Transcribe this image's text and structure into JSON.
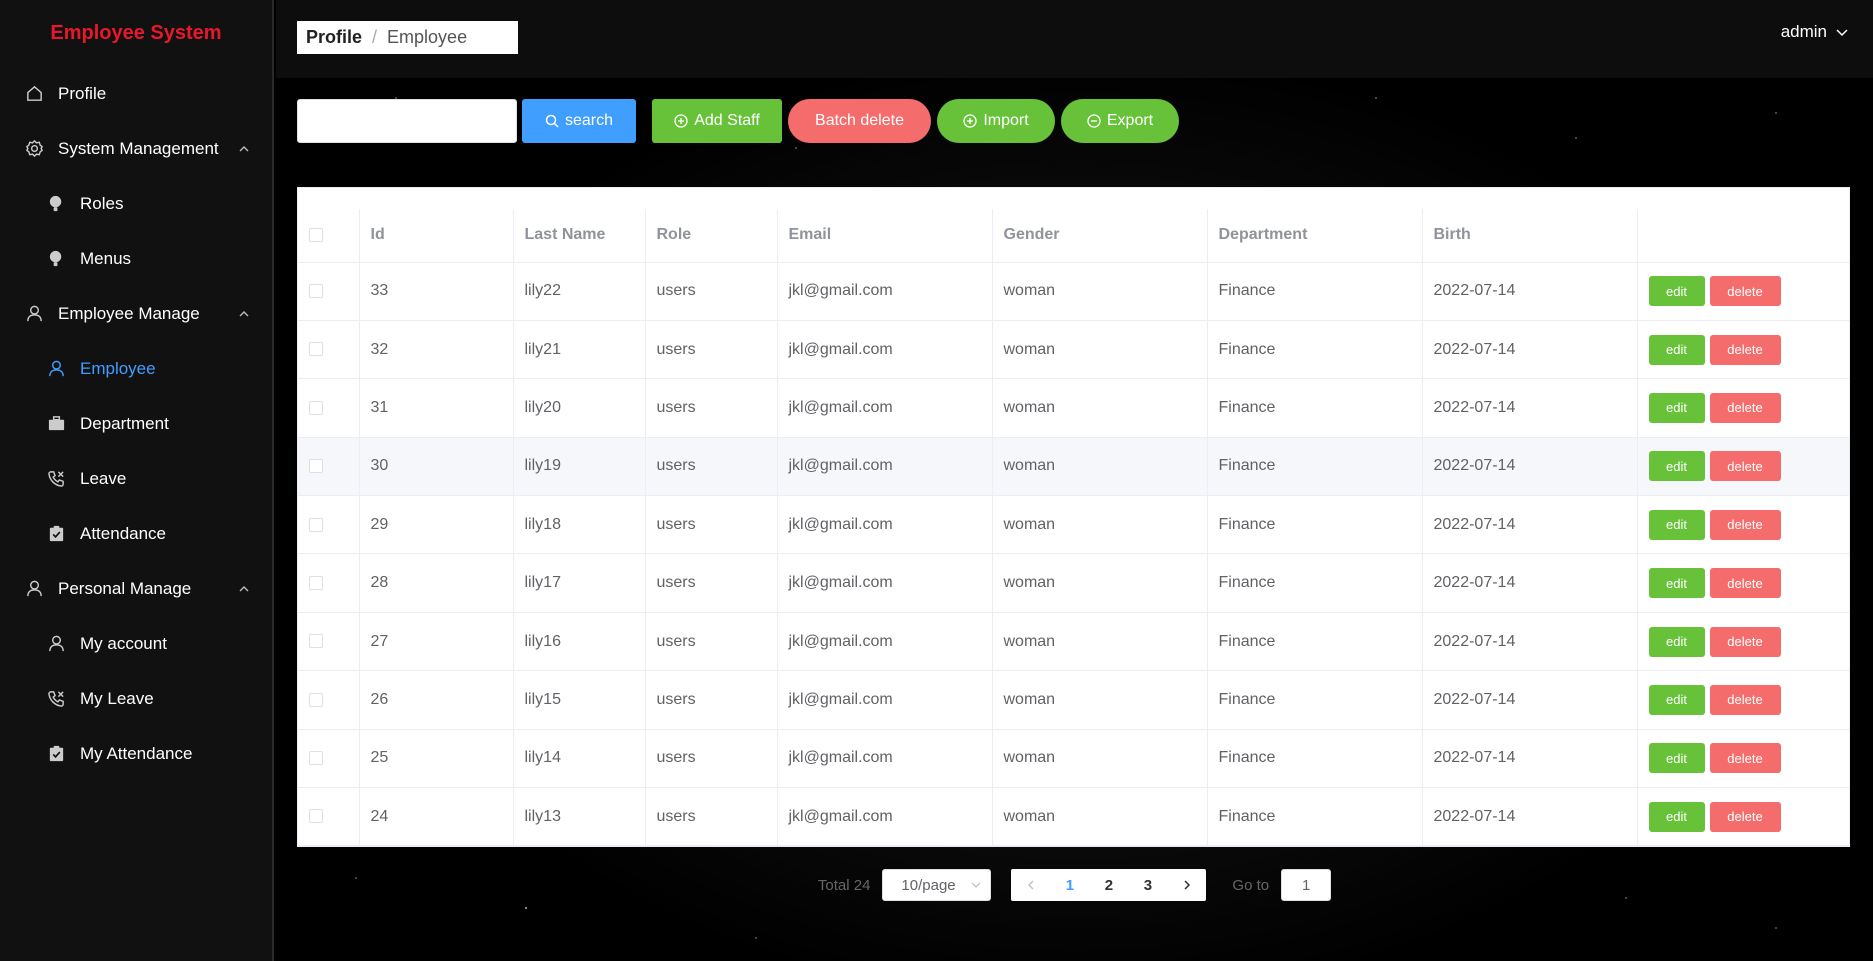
{
  "app": {
    "title": "Employee System"
  },
  "sidebar": {
    "items": [
      {
        "label": "Profile",
        "icon": "home-icon"
      },
      {
        "label": "System Management",
        "icon": "gear-icon"
      },
      {
        "label": "Roles",
        "icon": "bulb-icon"
      },
      {
        "label": "Menus",
        "icon": "bulb-icon"
      },
      {
        "label": "Employee Manage",
        "icon": "user-icon"
      },
      {
        "label": "Employee",
        "icon": "user-icon",
        "active": true
      },
      {
        "label": "Department",
        "icon": "briefcase-icon"
      },
      {
        "label": "Leave",
        "icon": "phone-icon"
      },
      {
        "label": "Attendance",
        "icon": "clipboard-check-icon"
      },
      {
        "label": "Personal Manage",
        "icon": "user-icon"
      },
      {
        "label": "My account",
        "icon": "user-icon"
      },
      {
        "label": "My Leave",
        "icon": "phone-icon"
      },
      {
        "label": "My Attendance",
        "icon": "clipboard-check-icon"
      }
    ]
  },
  "header": {
    "breadcrumb": [
      "Profile",
      "Employee"
    ],
    "user": "admin"
  },
  "toolbar": {
    "search_value": "",
    "search_label": "search",
    "add_label": "Add Staff",
    "batch_delete_label": "Batch delete",
    "import_label": "Import",
    "export_label": "Export"
  },
  "table": {
    "headers": [
      "Id",
      "Last Name",
      "Role",
      "Email",
      "Gender",
      "Department",
      "Birth"
    ],
    "edit_label": "edit",
    "delete_label": "delete",
    "rows": [
      [
        "33",
        "lily22",
        "users",
        "jkl@gmail.com",
        "woman",
        "Finance",
        "2022-07-14"
      ],
      [
        "32",
        "lily21",
        "users",
        "jkl@gmail.com",
        "woman",
        "Finance",
        "2022-07-14"
      ],
      [
        "31",
        "lily20",
        "users",
        "jkl@gmail.com",
        "woman",
        "Finance",
        "2022-07-14"
      ],
      [
        "30",
        "lily19",
        "users",
        "jkl@gmail.com",
        "woman",
        "Finance",
        "2022-07-14"
      ],
      [
        "29",
        "lily18",
        "users",
        "jkl@gmail.com",
        "woman",
        "Finance",
        "2022-07-14"
      ],
      [
        "28",
        "lily17",
        "users",
        "jkl@gmail.com",
        "woman",
        "Finance",
        "2022-07-14"
      ],
      [
        "27",
        "lily16",
        "users",
        "jkl@gmail.com",
        "woman",
        "Finance",
        "2022-07-14"
      ],
      [
        "26",
        "lily15",
        "users",
        "jkl@gmail.com",
        "woman",
        "Finance",
        "2022-07-14"
      ],
      [
        "25",
        "lily14",
        "users",
        "jkl@gmail.com",
        "woman",
        "Finance",
        "2022-07-14"
      ],
      [
        "24",
        "lily13",
        "users",
        "jkl@gmail.com",
        "woman",
        "Finance",
        "2022-07-14"
      ]
    ]
  },
  "pagination": {
    "total": "Total 24",
    "page_size": "10/page",
    "pages": [
      "1",
      "2",
      "3"
    ],
    "current": "1",
    "goto_label": "Go to",
    "goto_value": "1"
  },
  "colors": {
    "primary": "#409eff",
    "success": "#67c23a",
    "danger": "#f56c6c",
    "brand": "#e8182a"
  }
}
